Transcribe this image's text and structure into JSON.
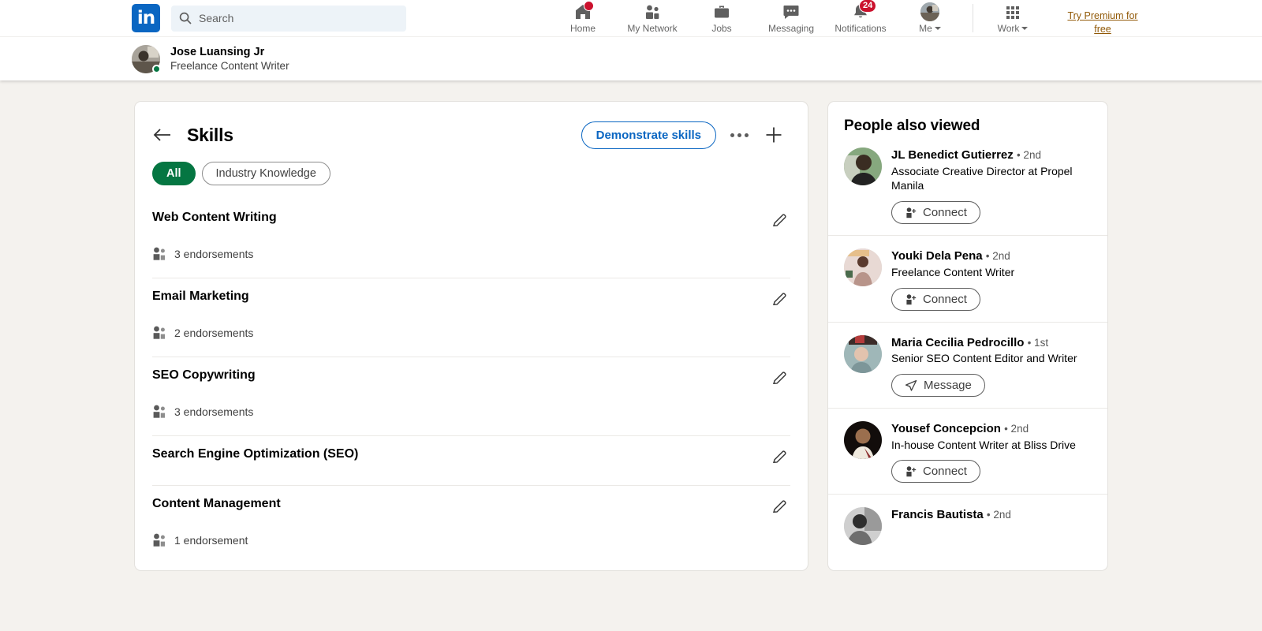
{
  "nav": {
    "logo_text": "in",
    "search": {
      "placeholder": "Search",
      "value": ""
    },
    "items": [
      {
        "label": "Home",
        "icon": "home-icon",
        "badge": ""
      },
      {
        "label": "My Network",
        "icon": "people-icon",
        "badge": ""
      },
      {
        "label": "Jobs",
        "icon": "briefcase-icon",
        "badge": ""
      },
      {
        "label": "Messaging",
        "icon": "message-bubble-icon",
        "badge": ""
      },
      {
        "label": "Notifications",
        "icon": "bell-icon",
        "badge": "24"
      },
      {
        "label": "Me",
        "icon": "avatar-icon",
        "badge": ""
      }
    ],
    "work": {
      "label": "Work",
      "icon": "grid-icon"
    },
    "premium_link": "Try Premium for free"
  },
  "subheader": {
    "name": "Jose Luansing Jr",
    "headline": "Freelance Content Writer"
  },
  "skills_card": {
    "title": "Skills",
    "back_icon": "back-arrow-icon",
    "demonstrate_label": "Demonstrate skills",
    "more_icon": "more-options-icon",
    "add_icon": "plus-icon",
    "filters": [
      {
        "label": "All",
        "active": true
      },
      {
        "label": "Industry Knowledge",
        "active": false
      }
    ],
    "skills": [
      {
        "name": "Web Content Writing",
        "endorsements": "3 endorsements"
      },
      {
        "name": "Email Marketing",
        "endorsements": "2 endorsements"
      },
      {
        "name": "SEO Copywriting",
        "endorsements": "3 endorsements"
      },
      {
        "name": "Search Engine Optimization (SEO)",
        "endorsements": ""
      },
      {
        "name": "Content Management",
        "endorsements": "1 endorsement"
      }
    ]
  },
  "people_also_viewed": {
    "title": "People also viewed",
    "people": [
      {
        "name": "JL Benedict Gutierrez",
        "degree": "• 2nd",
        "headline": "Associate Creative Director at Propel Manila",
        "action": "Connect",
        "action_icon": "person-plus-icon"
      },
      {
        "name": "Youki Dela Pena",
        "degree": "• 2nd",
        "headline": "Freelance Content Writer",
        "action": "Connect",
        "action_icon": "person-plus-icon"
      },
      {
        "name": "Maria Cecilia Pedrocillo",
        "degree": "• 1st",
        "headline": "Senior SEO Content Editor and Writer",
        "action": "Message",
        "action_icon": "send-icon"
      },
      {
        "name": "Yousef Concepcion",
        "degree": "• 2nd",
        "headline": "In-house Content Writer at Bliss Drive",
        "action": "Connect",
        "action_icon": "person-plus-icon"
      },
      {
        "name": "Francis Bautista",
        "degree": "• 2nd",
        "headline": "",
        "action": "",
        "action_icon": ""
      }
    ]
  },
  "colors": {
    "brand_blue": "#0a66c2",
    "page_bg": "#f4f2ee",
    "green_pill": "#057642",
    "badge_red": "#cb112d",
    "premium_gold": "#915907"
  }
}
